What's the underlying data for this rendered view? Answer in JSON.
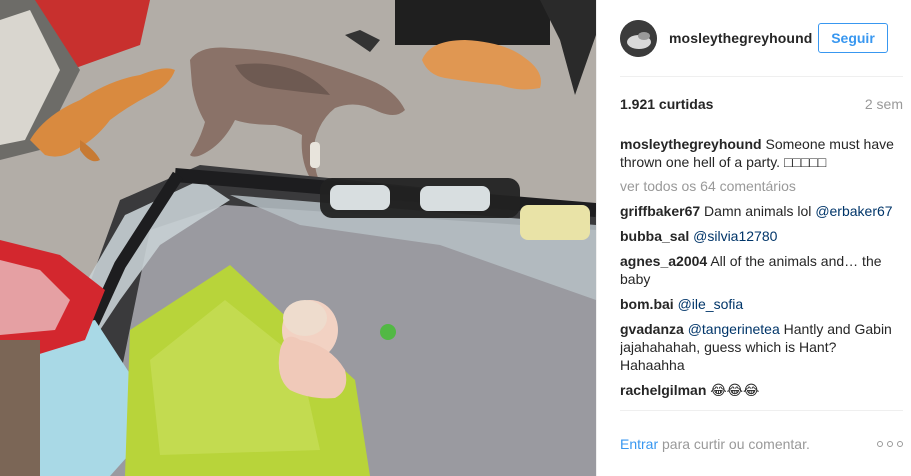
{
  "post": {
    "username": "mosleythegreyhound",
    "follow_label": "Seguir",
    "likes": "1.921 curtidas",
    "time": "2 sem",
    "caption": {
      "user": "mosleythegreyhound",
      "text": "Someone must have thrown one hell of a party.",
      "emoji": "□□□□□"
    },
    "view_all": "ver todos os 64 comentários",
    "comments": [
      {
        "user": "griffbaker67",
        "text": "Damn animals lol",
        "mention": "@erbaker67",
        "after": ""
      },
      {
        "user": "bubba_sal",
        "text": "",
        "mention": "@silvia12780",
        "after": ""
      },
      {
        "user": "agnes_a2004",
        "text": "All of the animals and… the baby",
        "mention": "",
        "after": ""
      },
      {
        "user": "bom.bai",
        "text": "",
        "mention": "@ile_sofia",
        "after": ""
      },
      {
        "user": "gvadanza",
        "text": "",
        "mention": "@tangerinetea",
        "after": "Hantly and Gabin jajahahahah, guess which is Hant? Hahaahha"
      },
      {
        "user": "rachelgilman",
        "text": "😂😂😂",
        "mention": "",
        "after": ""
      }
    ],
    "login_link": "Entrar",
    "login_text": " para curtir ou comentar."
  },
  "icons": {
    "more_options": "more-options-icon"
  },
  "colors": {
    "accent": "#3897f0",
    "mention": "#003569",
    "muted": "#999999",
    "text": "#262626"
  }
}
